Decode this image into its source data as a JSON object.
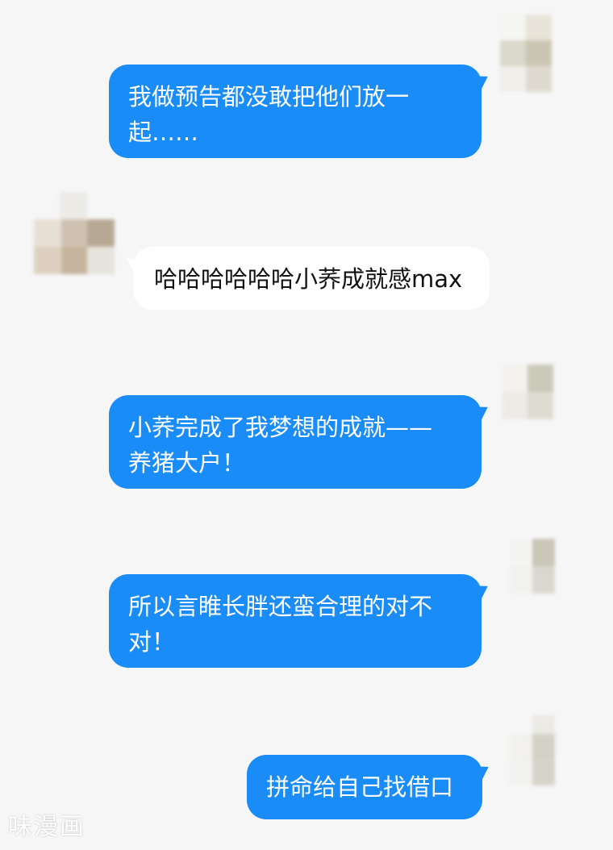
{
  "messages": [
    {
      "side": "sent",
      "text": "我做预告都没敢把他们放一\n起……"
    },
    {
      "side": "received",
      "text": "哈哈哈哈哈哈小荞成就感max"
    },
    {
      "side": "sent",
      "text": "小荞完成了我梦想的成就——\n养猪大户！"
    },
    {
      "side": "sent",
      "text": "所以言睢长胖还蛮合理的对不\n对！"
    },
    {
      "side": "sent",
      "text": "拼命给自己找借口"
    }
  ],
  "watermark": "味漫画",
  "colors": {
    "sent_bubble": "#1a8cf7",
    "received_bubble": "#ffffff",
    "background": "#f6f6f7"
  }
}
